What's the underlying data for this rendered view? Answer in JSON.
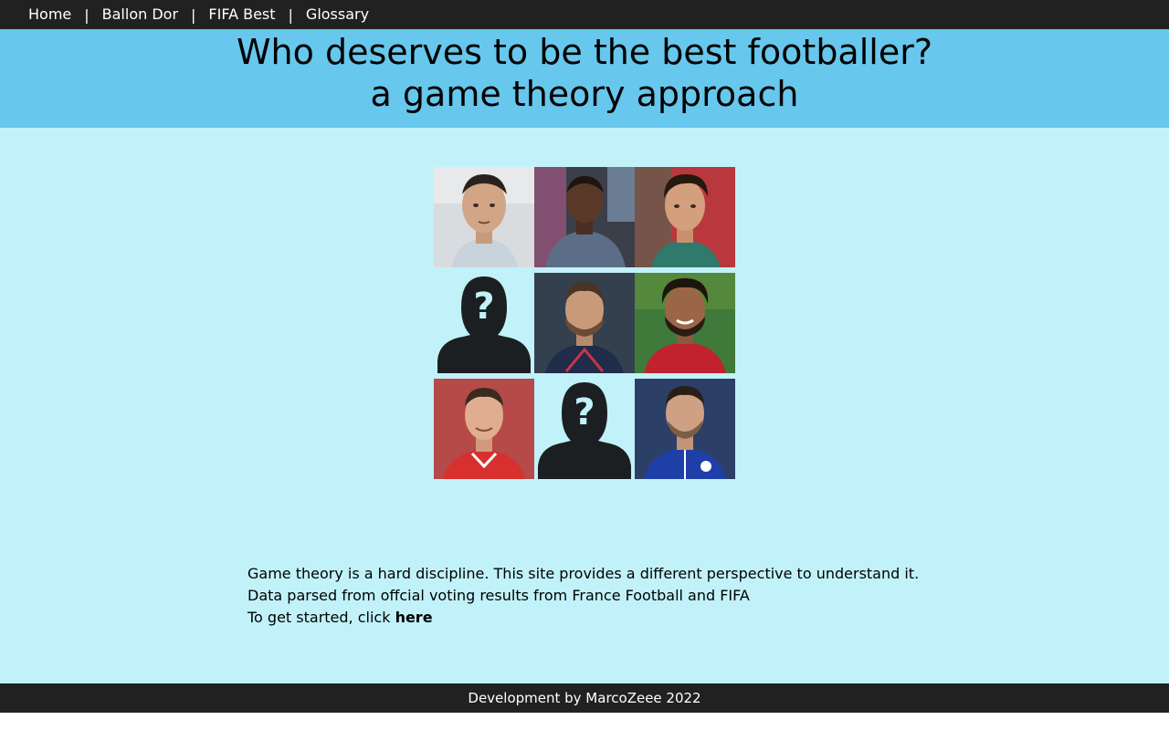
{
  "nav": {
    "items": [
      {
        "label": "Home"
      },
      {
        "label": "Ballon Dor"
      },
      {
        "label": "FIFA Best"
      },
      {
        "label": "Glossary"
      }
    ],
    "separator": "|"
  },
  "header": {
    "title_line1": "Who deserves to be the best footballer?",
    "title_line2": "a game theory approach"
  },
  "grid": {
    "tiles": [
      {
        "kind": "photo",
        "icon": "player-photo"
      },
      {
        "kind": "photo",
        "icon": "player-photo"
      },
      {
        "kind": "photo",
        "icon": "player-photo"
      },
      {
        "kind": "unknown",
        "icon": "unknown-person-icon",
        "glyph": "?"
      },
      {
        "kind": "photo",
        "icon": "player-photo"
      },
      {
        "kind": "photo",
        "icon": "player-photo"
      },
      {
        "kind": "photo",
        "icon": "player-photo"
      },
      {
        "kind": "unknown",
        "icon": "unknown-person-icon",
        "glyph": "?"
      },
      {
        "kind": "photo",
        "icon": "player-photo"
      }
    ]
  },
  "intro": {
    "line1": "Game theory is a hard discipline. This site provides a different perspective to understand it.",
    "line2": "Data parsed from offcial voting results from France Football and FIFA",
    "line3_prefix": "To get started, click ",
    "link_label": "here"
  },
  "footer": {
    "text": "Development by MarcoZeee 2022"
  },
  "colors": {
    "nav_bg": "#212121",
    "banner_bg": "#67c7ec",
    "main_bg": "#c1f2f9",
    "silhouette": "#1c1f22"
  }
}
